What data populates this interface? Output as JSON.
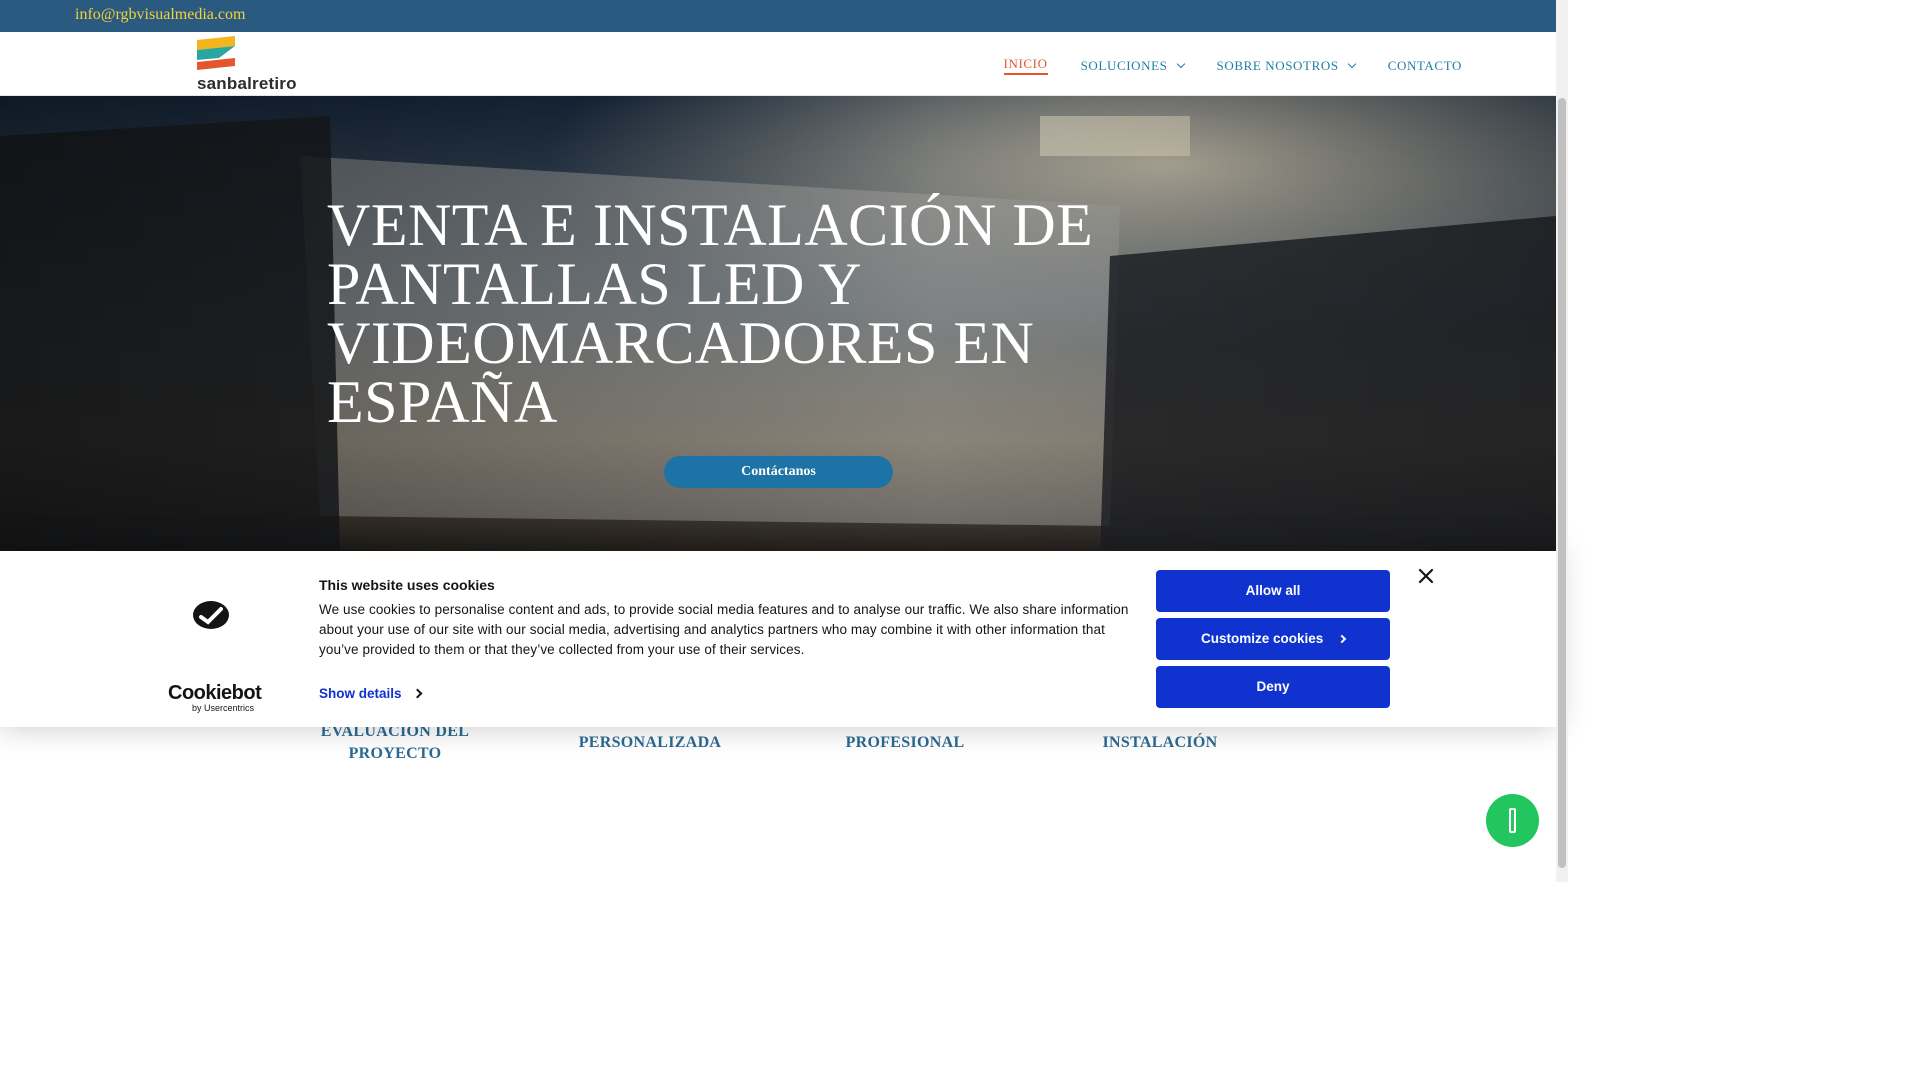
{
  "topbar": {
    "email": "info@rgbvisualmedia.com"
  },
  "header": {
    "logo_text": "sanbalretiro",
    "nav": [
      {
        "label": "INICIO",
        "active": true,
        "dropdown": false
      },
      {
        "label": "SOLUCIONES",
        "active": false,
        "dropdown": true
      },
      {
        "label": "SOBRE NOSOTROS",
        "active": false,
        "dropdown": true
      },
      {
        "label": "CONTACTO",
        "active": false,
        "dropdown": false
      }
    ]
  },
  "hero": {
    "title": "VENTA E INSTALACIÓN DE PANTALLAS LED Y VIDEOMARCADORES EN ESPAÑA",
    "cta_label": "Contáctanos",
    "background": "stadium-at-dusk-image"
  },
  "features": [
    {
      "label": "EVALUACIÓN DEL PROYECTO"
    },
    {
      "label": "PERSONALIZADA"
    },
    {
      "label": "PROFESIONAL"
    },
    {
      "label": "INSTALACIÓN"
    }
  ],
  "cookie_banner": {
    "title": "This website uses cookies",
    "body": "We use cookies to personalise content and ads, to provide social media features and to analyse our traffic. We also share information about your use of our site with our social media, advertising and analytics partners who may combine it with other information that you’ve provided to them or that they’ve collected from your use of their services.",
    "show_details": "Show details",
    "allow_all": "Allow all",
    "customize": "Customize cookies",
    "deny": "Deny",
    "brand": "Cookiebot",
    "brand_sub": "by Usercentrics"
  },
  "colors": {
    "topbar": "#2b5a80",
    "email": "#f3d23a",
    "nav": "#1e7fa6",
    "nav_active": "#e4572e",
    "cta": "#1e73a6",
    "cookie_button": "#1032cf",
    "whatsapp": "#22c55e"
  }
}
